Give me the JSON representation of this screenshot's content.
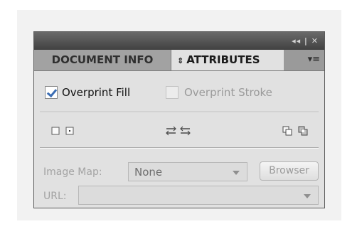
{
  "panel": {
    "title_controls": "◂◂ | ✕",
    "tabs": [
      {
        "label": "DOCUMENT INFO",
        "active": false
      },
      {
        "label": "ATTRIBUTES",
        "active": true,
        "prefix": "⇕"
      }
    ],
    "menu_glyph": "▾≡"
  },
  "overprint": {
    "fill_label": "Overprint Fill",
    "fill_checked": true,
    "stroke_label": "Overprint Stroke",
    "stroke_checked": false,
    "stroke_enabled": false
  },
  "icons": [
    "hide-center-icon",
    "show-center-icon",
    "reverse-path-direction-off-icon",
    "reverse-path-direction-on-icon",
    "use-non-zero-winding-fill-icon",
    "use-even-odd-fill-icon"
  ],
  "image_map": {
    "label": "Image Map:",
    "value": "None",
    "browser_label": "Browser"
  },
  "url": {
    "label": "URL:",
    "value": ""
  },
  "colors": {
    "accent": "#3b6db3",
    "titlebar": "#4a4a4a",
    "panel_bg": "#e1e1e1"
  }
}
